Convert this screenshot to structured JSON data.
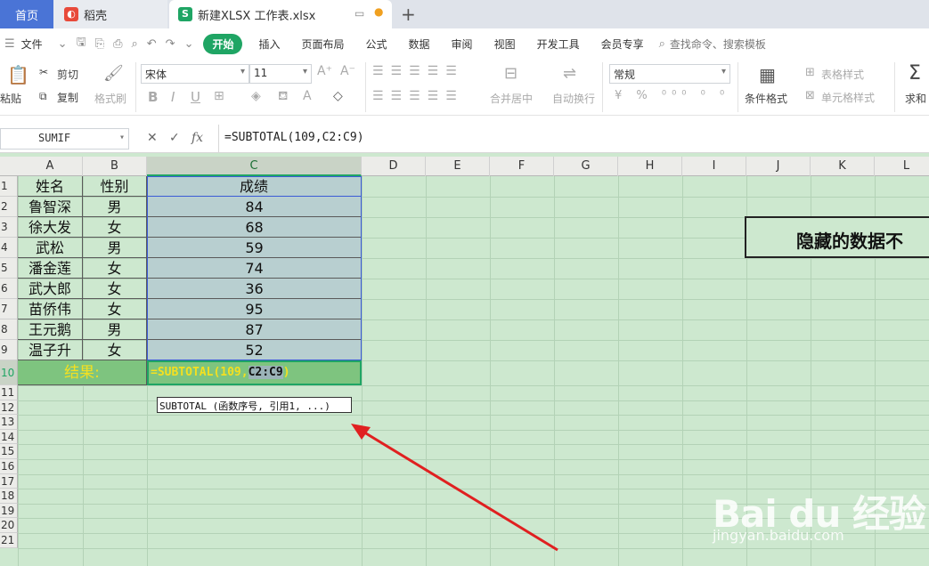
{
  "tabs": {
    "home": "首页",
    "docer": "稻壳",
    "file": "新建XLSX 工作表.xlsx"
  },
  "menu": {
    "file": "文件",
    "items": [
      "开始",
      "插入",
      "页面布局",
      "公式",
      "数据",
      "审阅",
      "视图",
      "开发工具",
      "会员专享"
    ],
    "search": "查找命令、搜索模板"
  },
  "ribbon": {
    "paste": "粘贴",
    "cut": "剪切",
    "copy": "复制",
    "format_painter": "格式刷",
    "font_name": "宋体",
    "font_size": "11",
    "merge_center": "合并居中",
    "wrap_text": "自动换行",
    "number_format": "常规",
    "conditional_format": "条件格式",
    "table_style": "表格样式",
    "cell_style": "单元格样式",
    "sum": "求和"
  },
  "formula_bar": {
    "name_box": "SUMIF",
    "formula": "=SUBTOTAL(109,C2:C9)"
  },
  "columns": [
    "A",
    "B",
    "C",
    "D",
    "E",
    "F",
    "G",
    "H",
    "I",
    "J",
    "K",
    "L"
  ],
  "rows": [
    "1",
    "2",
    "3",
    "4",
    "5",
    "6",
    "7",
    "8",
    "9",
    "10",
    "11",
    "12",
    "13",
    "14",
    "15",
    "16",
    "17",
    "18",
    "19",
    "20",
    "21"
  ],
  "table": {
    "headers": [
      "姓名",
      "性别",
      "成绩"
    ],
    "rows": [
      [
        "鲁智深",
        "男",
        "84"
      ],
      [
        "徐大发",
        "女",
        "68"
      ],
      [
        "武松",
        "男",
        "59"
      ],
      [
        "潘金莲",
        "女",
        "74"
      ],
      [
        "武大郎",
        "女",
        "36"
      ],
      [
        "苗侨伟",
        "女",
        "95"
      ],
      [
        "王元鹅",
        "男",
        "87"
      ],
      [
        "温子升",
        "女",
        "52"
      ]
    ],
    "result_label": "结果:",
    "result_formula_prefix": "=SUBTOTAL(109,",
    "result_formula_ref": "C2:C9",
    "result_formula_suffix": ")"
  },
  "tooltip": "SUBTOTAL (函数序号, 引用1, ...)",
  "callout": "隐藏的数据不",
  "watermark": {
    "logo": "Bai du 经验",
    "url": "jingyan.baidu.com"
  },
  "colors": {
    "accent": "#1fa564",
    "sheet_bg": "#cde8cf",
    "selection_bg": "#b8cfd0",
    "arrow": "#e02020",
    "result_text": "#f4e020"
  }
}
